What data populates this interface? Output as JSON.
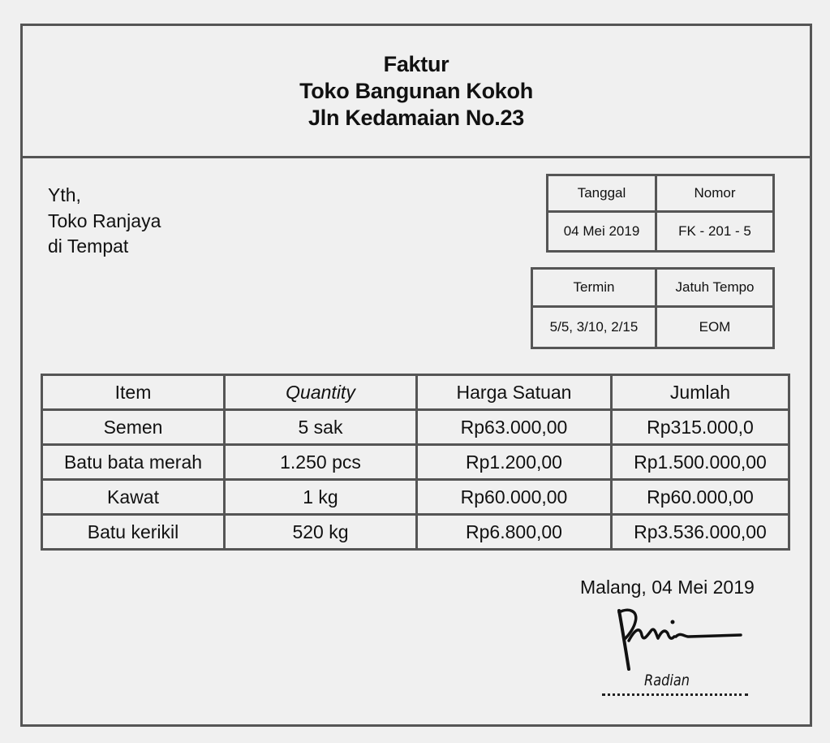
{
  "header": {
    "title": "Faktur",
    "store_name": "Toko Bangunan Kokoh",
    "address": "Jln Kedamaian No.23"
  },
  "recipient": {
    "salutation": "Yth,",
    "name": "Toko Ranjaya",
    "location": "di Tempat"
  },
  "invoice_info": {
    "date_label": "Tanggal",
    "date_value": "04 Mei 2019",
    "number_label": "Nomor",
    "number_value": "FK - 201 - 5",
    "terms_label": "Termin",
    "terms_value": "5/5, 3/10, 2/15",
    "due_label": "Jatuh Tempo",
    "due_value": "EOM"
  },
  "items_table": {
    "headers": [
      "Item",
      "Quantity",
      "Harga Satuan",
      "Jumlah"
    ],
    "rows": [
      [
        "Semen",
        "5 sak",
        "Rp63.000,00",
        "Rp315.000,0"
      ],
      [
        "Batu bata merah",
        "1.250 pcs",
        "Rp1.200,00",
        "Rp1.500.000,00"
      ],
      [
        "Kawat",
        "1 kg",
        "Rp60.000,00",
        "Rp60.000,00"
      ],
      [
        "Batu kerikil",
        "520 kg",
        "Rp6.800,00",
        "Rp3.536.000,00"
      ]
    ]
  },
  "footer": {
    "place_date": "Malang, 04 Mei 2019",
    "signer_name": "Radian",
    "signature_icon": "handwritten-signature"
  }
}
